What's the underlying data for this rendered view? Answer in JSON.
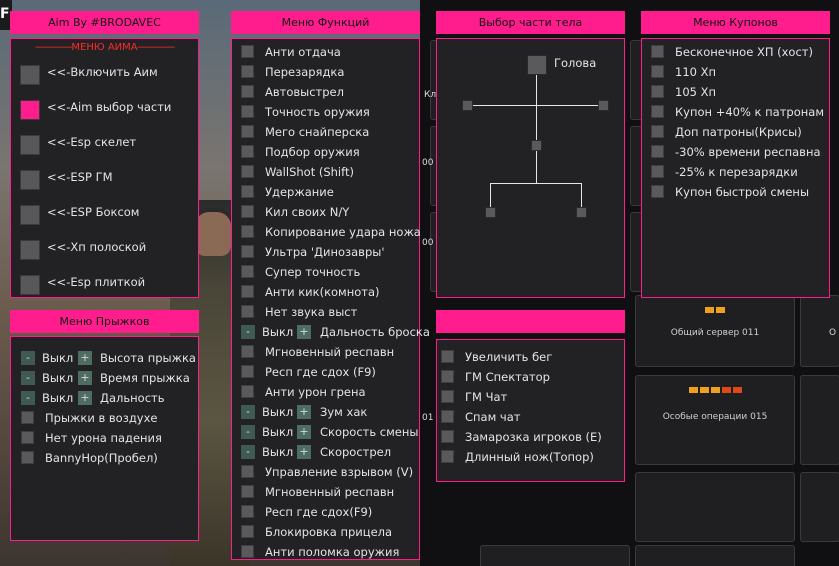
{
  "background": {
    "tiles": [
      "Общий сервер 011",
      "Особые операции 015"
    ],
    "fragments": [
      "00",
      "00",
      "Кл",
      "01",
      "О"
    ]
  },
  "aim_panel": {
    "title": "Aim By #BRODAVEC",
    "subtitle": "МЕНЮ АИМА",
    "items": [
      {
        "label": "<<-Включить Аим",
        "checked": false
      },
      {
        "label": "<<-Aim выбор части",
        "checked": true
      },
      {
        "label": "<<-Esp скелет",
        "checked": false
      },
      {
        "label": "<<-ESP ГМ",
        "checked": false
      },
      {
        "label": "<<-ESP Боксом",
        "checked": false
      },
      {
        "label": "<<-Хп полоской",
        "checked": false
      },
      {
        "label": "<<-Esp плиткой",
        "checked": false
      }
    ]
  },
  "jump_panel": {
    "title": "Меню Прыжков",
    "toggles": [
      {
        "minus": "-",
        "off": "Выкл",
        "plus": "+",
        "label": "Высота прыжка"
      },
      {
        "minus": "-",
        "off": "Выкл",
        "plus": "+",
        "label": "Время прыжка"
      },
      {
        "minus": "-",
        "off": "Выкл",
        "plus": "+",
        "label": "Дальность"
      }
    ],
    "items": [
      "Прыжки в воздухе",
      "Нет урона падения",
      "BannyHop(Пробел)"
    ]
  },
  "func_panel": {
    "title": "Меню Функций",
    "items": [
      {
        "label": "Анти отдача"
      },
      {
        "label": "Перезарядка"
      },
      {
        "label": "Автовыстрел"
      },
      {
        "label": "Точность оружия"
      },
      {
        "label": "Мего снайперска"
      },
      {
        "label": "Подбор оружия"
      },
      {
        "label": "WallShot (Shift)"
      },
      {
        "label": "Удержание"
      },
      {
        "label": "Кил своих N/Y"
      },
      {
        "label": "Копирование удара ножа"
      },
      {
        "label": "Ультра 'Динозавры'"
      },
      {
        "label": "Супер точность"
      },
      {
        "label": "Анти кик(комнота)"
      },
      {
        "label": "Нет звука выст"
      },
      {
        "label": "Дальность броска",
        "minus": "-",
        "off": "Выкл",
        "plus": "+"
      },
      {
        "label": "Мгновенный респавн"
      },
      {
        "label": "Респ где сдох (F9)"
      },
      {
        "label": "Анти урон грена"
      },
      {
        "label": "Зум хак",
        "minus": "-",
        "off": "Выкл",
        "plus": "+"
      },
      {
        "label": "Скорость смены",
        "minus": "-",
        "off": "Выкл",
        "plus": "+"
      },
      {
        "label": "Скорострел",
        "minus": "-",
        "off": "Выкл",
        "plus": "+"
      },
      {
        "label": "Управление взрывом (V)"
      },
      {
        "label": "Мгновенный респавн"
      },
      {
        "label": "Респ где сдох(F9)"
      },
      {
        "label": "Блокировка прицела"
      },
      {
        "label": "Анти поломка оружия"
      }
    ]
  },
  "body_panel": {
    "title": "Выбор части тела",
    "head_label": "Голова"
  },
  "extra_panel": {
    "title": "",
    "items": [
      "Увеличить бег",
      "ГМ Спектатор",
      "ГМ Чат",
      "Спам чат",
      "Замарозка игроков (E)",
      "Длинный нож(Топор)"
    ]
  },
  "coupon_panel": {
    "title": "Меню Купонов",
    "items": [
      "Бесконечное ХП (хост)",
      "110 Хп",
      "105 Хп",
      "Купон +40% к патронам",
      "Доп патроны(Крисы)",
      "-30% времени респавна",
      "-25% к перезарядки",
      "Купон быстрой смены"
    ]
  },
  "colors": {
    "accent": "#ff1d8e",
    "panel": "#222224",
    "checkbox": "#5a5a5c",
    "aim_subtitle": "#ff2a2a"
  }
}
